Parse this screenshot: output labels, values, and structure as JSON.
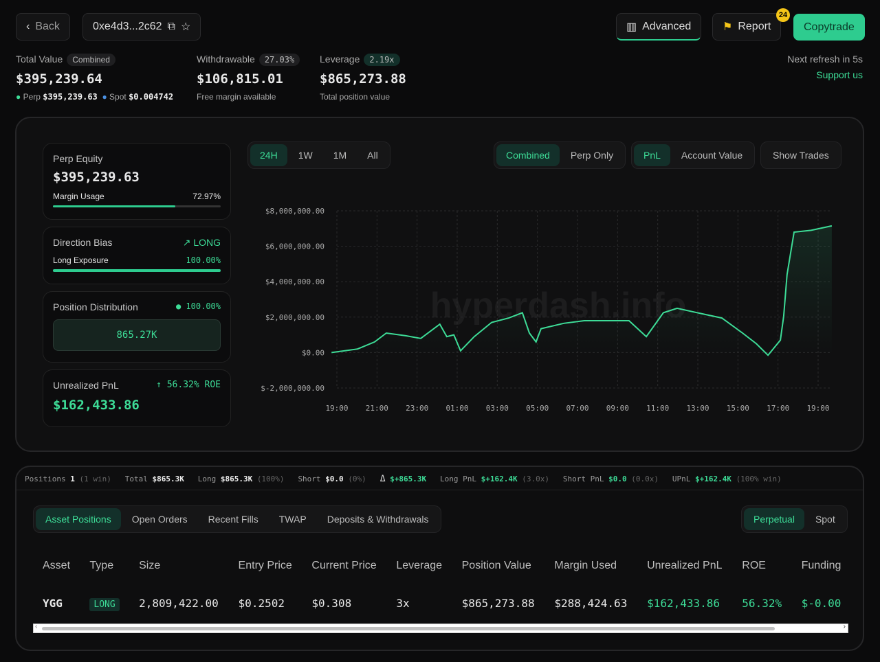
{
  "header": {
    "back": "Back",
    "address": "0xe4d3...2c62",
    "advanced": "Advanced",
    "report": "Report",
    "report_badge": "24",
    "copytrade": "Copytrade",
    "refresh": "Next refresh in 5s",
    "support": "Support us"
  },
  "stats": {
    "total": {
      "label": "Total Value",
      "badge": "Combined",
      "value": "$395,239.64",
      "perp_label": "Perp",
      "perp": "$395,239.63",
      "spot_label": "Spot",
      "spot": "$0.004742"
    },
    "withdrawable": {
      "label": "Withdrawable",
      "badge": "27.03%",
      "value": "$106,815.01",
      "sub": "Free margin available"
    },
    "leverage": {
      "label": "Leverage",
      "badge": "2.19x",
      "value": "$865,273.88",
      "sub": "Total position value"
    }
  },
  "cards": {
    "equity": {
      "title": "Perp Equity",
      "value": "$395,239.63",
      "usage_label": "Margin Usage",
      "usage": "72.97%",
      "usage_frac": 0.7297
    },
    "bias": {
      "title": "Direction Bias",
      "dir": "LONG",
      "exp_label": "Long Exposure",
      "exp": "100.00%",
      "exp_frac": 1.0
    },
    "dist": {
      "title": "Position Distribution",
      "pct": "100.00%",
      "value": "865.27K"
    },
    "upnl": {
      "title": "Unrealized PnL",
      "roe": "56.32% ROE",
      "value": "$162,433.86"
    }
  },
  "chart_tabs": {
    "range": [
      "24H",
      "1W",
      "1M",
      "All"
    ],
    "mode": [
      "Combined",
      "Perp Only"
    ],
    "metric": [
      "PnL",
      "Account Value"
    ],
    "trades": "Show Trades"
  },
  "watermark": "hyperdash.info",
  "chart_data": {
    "type": "area",
    "ylim": [
      -2000000,
      8000000
    ],
    "grid": true,
    "yticks": [
      "$8,000,000.00",
      "$6,000,000.00",
      "$4,000,000.00",
      "$2,000,000.00",
      "$0.00",
      "$-2,000,000.00"
    ],
    "xticks": [
      "19:00",
      "21:00",
      "23:00",
      "01:00",
      "03:00",
      "05:00",
      "07:00",
      "09:00",
      "11:00",
      "13:00",
      "15:00",
      "17:00",
      "19:00"
    ],
    "points": [
      [
        "18:44",
        0
      ],
      [
        "20:02",
        200000
      ],
      [
        "20:53",
        600000
      ],
      [
        "21:28",
        1100000
      ],
      [
        "22:26",
        950000
      ],
      [
        "23:11",
        800000
      ],
      [
        "00:08",
        1600000
      ],
      [
        "00:29",
        900000
      ],
      [
        "00:50",
        1000000
      ],
      [
        "01:10",
        100000
      ],
      [
        "01:51",
        900000
      ],
      [
        "02:43",
        1700000
      ],
      [
        "03:34",
        1950000
      ],
      [
        "04:15",
        2250000
      ],
      [
        "04:36",
        1100000
      ],
      [
        "04:56",
        600000
      ],
      [
        "05:11",
        1350000
      ],
      [
        "06:19",
        1650000
      ],
      [
        "07:20",
        1800000
      ],
      [
        "09:34",
        1800000
      ],
      [
        "10:26",
        900000
      ],
      [
        "11:17",
        2250000
      ],
      [
        "11:58",
        2500000
      ],
      [
        "13:10",
        2200000
      ],
      [
        "14:12",
        1950000
      ],
      [
        "15:14",
        1100000
      ],
      [
        "15:55",
        500000
      ],
      [
        "16:30",
        -150000
      ],
      [
        "17:07",
        700000
      ],
      [
        "17:17",
        2050000
      ],
      [
        "17:27",
        4400000
      ],
      [
        "17:48",
        6800000
      ],
      [
        "18:39",
        6900000
      ],
      [
        "19:41",
        7150000
      ]
    ]
  },
  "summary": {
    "positions": "Positions",
    "pos_n": "1",
    "pos_win": "(1 win)",
    "total": "Total",
    "total_v": "$865.3K",
    "long": "Long",
    "long_v": "$865.3K",
    "long_p": "(100%)",
    "short": "Short",
    "short_v": "$0.0",
    "short_p": "(0%)",
    "delta": "Δ",
    "delta_v": "$+865.3K",
    "lpnl": "Long PnL",
    "lpnl_v": "$+162.4K",
    "lpnl_x": "(3.0x)",
    "spnl": "Short PnL",
    "spnl_v": "$0.0",
    "spnl_x": "(0.0x)",
    "upnl": "UPnL",
    "upnl_v": "$+162.4K",
    "upnl_w": "(100% win)"
  },
  "tabs": [
    "Asset Positions",
    "Open Orders",
    "Recent Fills",
    "TWAP",
    "Deposits & Withdrawals"
  ],
  "market_tabs": [
    "Perpetual",
    "Spot"
  ],
  "table": {
    "headers": [
      "Asset",
      "Type",
      "Size",
      "Entry Price",
      "Current Price",
      "Leverage",
      "Position Value",
      "Margin Used",
      "Unrealized PnL",
      "ROE",
      "Funding"
    ],
    "rows": [
      [
        "YGG",
        "LONG",
        "2,809,422.00",
        "$0.2502",
        "$0.308",
        "3x",
        "$865,273.88",
        "$288,424.63",
        "$162,433.86",
        "56.32%",
        "$-0.00"
      ]
    ]
  }
}
